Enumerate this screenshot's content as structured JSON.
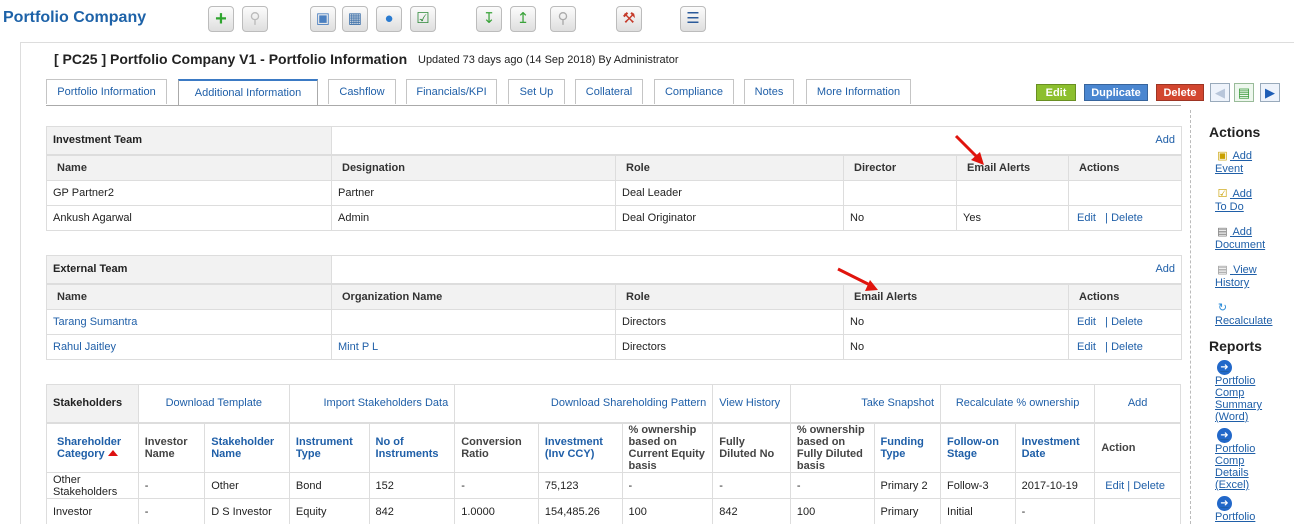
{
  "app": {
    "title": "Portfolio Company"
  },
  "toolbar": {
    "icons": [
      "add-icon",
      "search-icon",
      "window-icon",
      "calculator-icon",
      "chat-icon",
      "clipboard-icon",
      "export-icon",
      "import-icon",
      "preview-icon",
      "tools-icon",
      "report-icon"
    ]
  },
  "page": {
    "title": "[ PC25 ] Portfolio Company V1 - Portfolio Information",
    "updated": "Updated 73 days ago (14 Sep 2018) By Administrator"
  },
  "tabs": [
    {
      "label": "Portfolio Information"
    },
    {
      "label": "Additional Information",
      "active": true
    },
    {
      "label": "Cashflow"
    },
    {
      "label": "Financials/KPI"
    },
    {
      "label": "Set Up"
    },
    {
      "label": "Collateral"
    },
    {
      "label": "Compliance"
    },
    {
      "label": "Notes"
    },
    {
      "label": "More Information"
    }
  ],
  "actions_bar": {
    "edit": "Edit",
    "duplicate": "Duplicate",
    "delete": "Delete"
  },
  "colors": {
    "edit": "#8cbf2e",
    "duplicate": "#4a86d0",
    "delete": "#d2462f",
    "link": "#1f5fa8",
    "arrow": "#e0140d"
  },
  "investment_team": {
    "title": "Investment Team",
    "add": "Add",
    "columns": [
      "Name",
      "Designation",
      "Role",
      "Director",
      "Email Alerts",
      "Actions"
    ],
    "rows": [
      {
        "name": "GP Partner2",
        "designation": "Partner",
        "role": "Deal Leader",
        "director": "",
        "email": "",
        "edit": "",
        "delete": ""
      },
      {
        "name": "Ankush Agarwal",
        "designation": "Admin",
        "role": "Deal Originator",
        "director": "No",
        "email": "Yes",
        "edit": "Edit",
        "delete": "Delete"
      }
    ]
  },
  "external_team": {
    "title": "External Team",
    "add": "Add",
    "columns": [
      "Name",
      "Organization Name",
      "Role",
      "Email Alerts",
      "Actions"
    ],
    "rows": [
      {
        "name": "Tarang Sumantra",
        "org": "",
        "role": "Directors",
        "email": "No",
        "edit": "Edit",
        "delete": "Delete"
      },
      {
        "name": "Rahul Jaitley",
        "org": "Mint P L",
        "role": "Directors",
        "email": "No",
        "edit": "Edit",
        "delete": "Delete"
      }
    ]
  },
  "stakeholders": {
    "title": "Stakeholders",
    "links": {
      "download_template": "Download Template",
      "import": "Import Stakeholders Data",
      "download_pattern": "Download Shareholding Pattern",
      "view_history": "View History",
      "snapshot": "Take Snapshot",
      "recalc": "Recalculate % ownership",
      "add": "Add"
    },
    "columns": [
      "Shareholder Category",
      "Investor Name",
      "Stakeholder Name",
      "Instrument Type",
      "No of Instruments",
      "Conversion Ratio",
      "Investment (Inv CCY)",
      "% ownership based on Current Equity basis",
      "Fully Diluted No",
      "% ownership based on Fully Diluted basis",
      "Funding Type",
      "Follow-on Stage",
      "Investment Date",
      "Action"
    ],
    "rows": [
      {
        "category": "Other Stakeholders",
        "investor": "-",
        "stakeholder": "Other",
        "instrument": "Bond",
        "num": "152",
        "ratio": "-",
        "investment": "75,123",
        "own_current": "-",
        "fully": "-",
        "own_fully": "-",
        "funding": "Primary 2",
        "stage": "Follow-3",
        "date": "2017-10-19",
        "edit": "Edit",
        "delete": "Delete"
      },
      {
        "category": "Investor",
        "investor": "-",
        "stakeholder": "D S Investor",
        "instrument": "Equity",
        "num": "842",
        "ratio": "1.0000",
        "investment": "154,485.26",
        "own_current": "100",
        "fully": "842",
        "own_fully": "100",
        "funding": "Primary",
        "stage": "Initial",
        "date": "-",
        "edit": "",
        "delete": ""
      }
    ]
  },
  "sidebar": {
    "actions_title": "Actions",
    "actions": [
      {
        "label1": "Add",
        "label2": "Event"
      },
      {
        "label1": "Add",
        "label2": "To Do"
      },
      {
        "label1": "Add",
        "label2": "Document"
      },
      {
        "label1": "View",
        "label2": "History"
      },
      {
        "label1": "",
        "label2": "Recalculate"
      }
    ],
    "reports_title": "Reports",
    "reports": [
      {
        "label": "Portfolio Comp Summary (Word)"
      },
      {
        "label": "Portfolio Comp Details (Excel)"
      },
      {
        "label": "Portfolio"
      }
    ]
  }
}
